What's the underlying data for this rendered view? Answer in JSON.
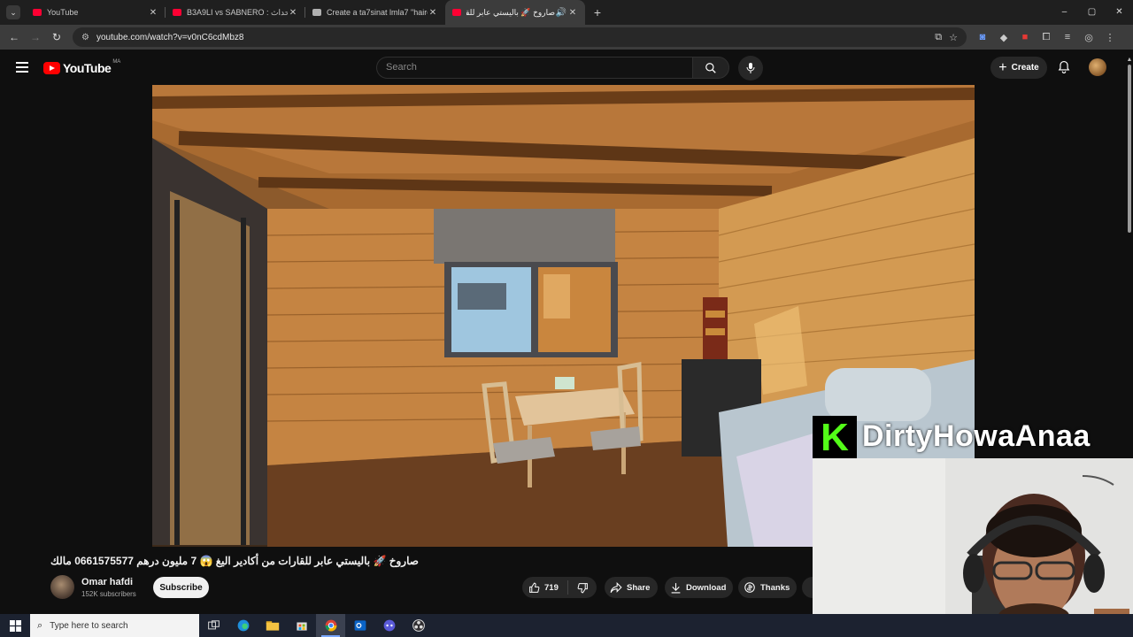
{
  "browser": {
    "tabs": [
      {
        "title": "YouTube",
        "icon": "youtube-icon",
        "active": false
      },
      {
        "title": "B3A9LI vs SABNERO : ع للأحداث",
        "icon": "youtube-icon",
        "active": false
      },
      {
        "title": "Create a ta7sinat lmla7 \"haircut",
        "icon": "document-icon",
        "active": false
      },
      {
        "title": "صاروخ 🚀 باليستي عابر للقار",
        "icon": "youtube-icon",
        "active": true
      }
    ],
    "new_tab": "+",
    "window_controls": [
      "–",
      "▢",
      "✕"
    ],
    "url": "youtube.com/watch?v=v0nC6cdMbz8"
  },
  "youtube": {
    "logo_text": "YouTube",
    "region": "MA",
    "search_placeholder": "Search",
    "create_label": "Create"
  },
  "video": {
    "title": "صاروخ 🚀 باليستي عابر للقارات من أكادير اليغ 😱 7 مليون درهم 0661575577 مالك",
    "channel": "Omar hafdi",
    "subscribers": "152K subscribers",
    "subscribe_label": "Subscribe",
    "likes": "719",
    "share_label": "Share",
    "download_label": "Download",
    "thanks_label": "Thanks"
  },
  "stream_overlay": {
    "badge": "K",
    "name": "DirtyHowaAnaa",
    "badge_color": "#53fc18"
  },
  "taskbar": {
    "search_placeholder": "Type here to search",
    "apps": [
      "task-view",
      "edge",
      "file-explorer",
      "store",
      "chrome",
      "outlook",
      "discord-like",
      "obs"
    ]
  }
}
